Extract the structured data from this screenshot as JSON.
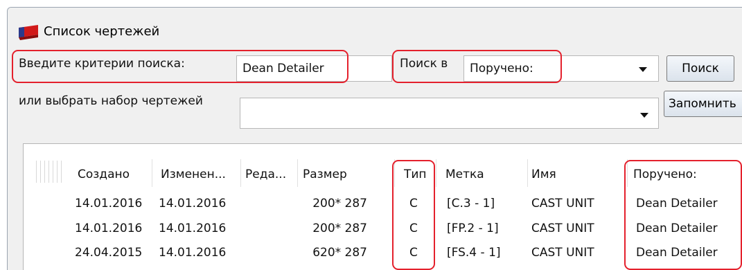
{
  "window": {
    "title": "Список чертежей",
    "icon": "drawing-list-icon"
  },
  "search": {
    "criteria_label": "Введите критерии поиска:",
    "criteria_value": "Dean Detailer",
    "search_in_label": "Поиск в",
    "search_in_value": "Поручено:",
    "search_button": "Поиск"
  },
  "drawing_set": {
    "label": "или выбрать набор чертежей",
    "value": "",
    "remember_button": "Запомнить"
  },
  "list": {
    "columns": [
      "Создано",
      "Изменен...",
      "Реда...",
      "Размер",
      "Тип",
      "Метка",
      "Имя",
      "Поручено:"
    ],
    "rows": [
      {
        "created": "14.01.2016",
        "modified": "14.01.2016",
        "edited": "",
        "size": "200* 287",
        "type": "C",
        "mark": "[C.3 - 1]",
        "name": "CAST UNIT",
        "assigned": "Dean Detailer"
      },
      {
        "created": "14.01.2016",
        "modified": "14.01.2016",
        "edited": "",
        "size": "200* 287",
        "type": "C",
        "mark": "[FP.2 - 1]",
        "name": "CAST UNIT",
        "assigned": "Dean Detailer"
      },
      {
        "created": "24.04.2015",
        "modified": "14.01.2016",
        "edited": "",
        "size": "620* 287",
        "type": "C",
        "mark": "[FS.4 - 1]",
        "name": "CAST UNIT",
        "assigned": "Dean Detailer"
      }
    ]
  },
  "colors": {
    "highlight": "#e4202c",
    "window_bg": "#f0f0f0",
    "icon_red": "#d11a1a"
  }
}
